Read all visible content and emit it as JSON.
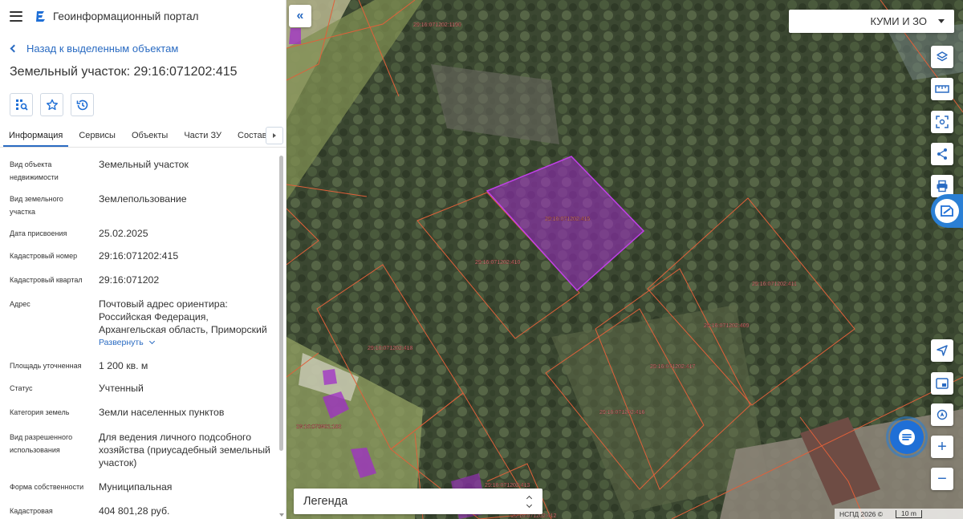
{
  "header": {
    "app_title": "Геоинформационный портал",
    "menu_icon": "menu-icon",
    "logo_icon": "portal-logo"
  },
  "panel": {
    "back_label": "Назад к выделенным объектам",
    "object_title": "Земельный участок: 29:16:071202:415",
    "tools": [
      "select-area-icon",
      "star-icon",
      "history-icon"
    ],
    "tabs": [
      "Информация",
      "Сервисы",
      "Объекты",
      "Части ЗУ",
      "Состав"
    ],
    "active_tab": "Информация",
    "properties": [
      {
        "label": "Вид объекта недвижимости",
        "value": "Земельный участок"
      },
      {
        "label": "Вид земельного участка",
        "value": "Землепользование"
      },
      {
        "label": "Дата присвоения",
        "value": "25.02.2025"
      },
      {
        "label": "Кадастровый номер",
        "value": "29:16:071202:415"
      },
      {
        "label": "Кадастровый квартал",
        "value": "29:16:071202"
      },
      {
        "label": "Адрес",
        "value": "Почтовый адрес ориентира: Российская Федерация, Архангельская область, Приморский"
      },
      {
        "label": "Площадь уточненная",
        "value": "1 200 кв. м"
      },
      {
        "label": "Статус",
        "value": "Учтенный"
      },
      {
        "label": "Категория земель",
        "value": "Земли населенных пунктов"
      },
      {
        "label": "Вид разрешенного использования",
        "value": "Для ведения личного подсобного хозяйства (приусадебный земельный участок)"
      },
      {
        "label": "Форма собственности",
        "value": "Муниципальная"
      },
      {
        "label": "Кадастровая",
        "value": "404 801,28 руб."
      }
    ],
    "expand_label": "Развернуть"
  },
  "map": {
    "layer_select": "КУМИ И ЗО",
    "legend_label": "Легенда",
    "attribution": "НСПД 2026 ©",
    "scale_label": "10 m",
    "zoom_in": "+",
    "zoom_out": "−",
    "parcel_labels": [
      "29:16:071202:1190",
      "29:16:071202:415",
      "29:16:071202:410",
      "29:16:071202:411",
      "29:16:071202:409",
      "29:16:071202:417",
      "29:16:071202:418",
      "29:16:071202:416",
      "29:16:070901:182",
      "29:16:071202:413",
      "29:16:071202:412"
    ],
    "right_controls": [
      "layers-icon",
      "ruler-icon",
      "area-select-icon",
      "share-icon",
      "print-icon",
      "active-tool-icon",
      "locate-icon",
      "minimap-icon",
      "geolocation-icon"
    ],
    "colors": {
      "accent": "#2a6bc2",
      "selected_parcel": "#a02cc8",
      "parcel_border": "#e0603a"
    }
  }
}
